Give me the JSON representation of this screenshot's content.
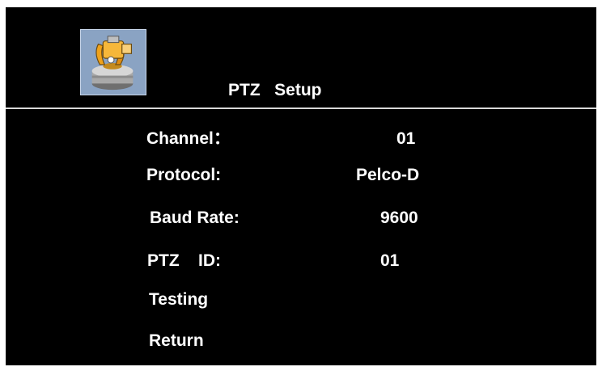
{
  "menu": {
    "title": "PTZ   Setup",
    "icon": "ptz-camera-icon",
    "items": [
      {
        "label": "Channel：",
        "value": "01"
      },
      {
        "label": "Protocol:",
        "value": "Pelco-D"
      },
      {
        "label": "Baud Rate:",
        "value": "9600"
      },
      {
        "label": "PTZ    ID:",
        "value": "01"
      },
      {
        "label": "Testing",
        "value": ""
      },
      {
        "label": "Return",
        "value": ""
      }
    ]
  },
  "colors": {
    "background": "#000000",
    "text": "#ffffff",
    "divider": "#d9d9d9",
    "icon_frame": "#8aa3c3",
    "icon_accent": "#f0a21a"
  }
}
